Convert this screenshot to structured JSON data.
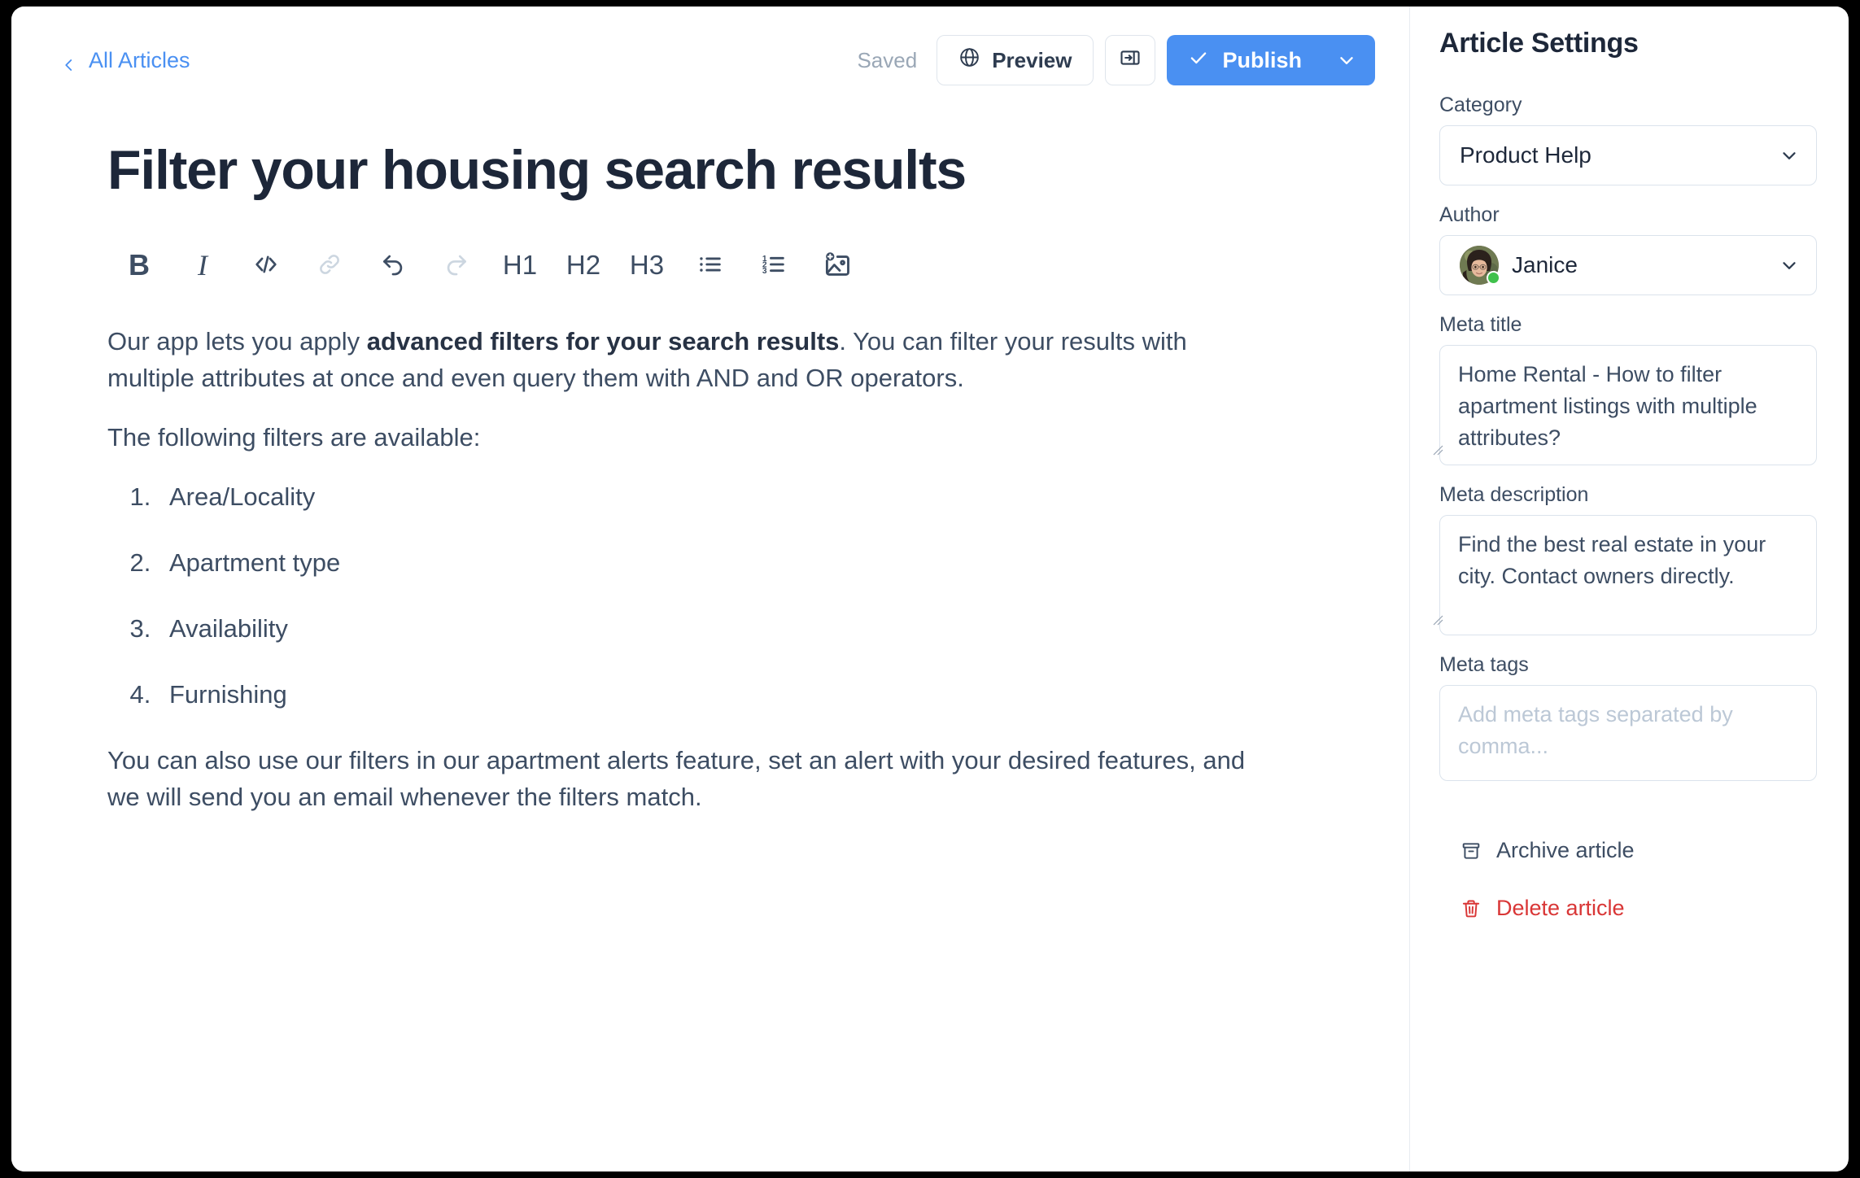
{
  "topbar": {
    "back_label": "All Articles",
    "saved_label": "Saved",
    "preview_label": "Preview",
    "publish_label": "Publish",
    "icons": {
      "back": "chevron-left-icon",
      "globe": "globe-icon",
      "panel": "panel-collapse-icon",
      "check": "check-icon",
      "caret": "chevron-down-icon"
    }
  },
  "article": {
    "title": "Filter your housing search results",
    "toolbar": [
      {
        "name": "bold",
        "label": "B",
        "kind": "bold",
        "disabled": false
      },
      {
        "name": "italic",
        "label": "I",
        "kind": "italic",
        "disabled": false
      },
      {
        "name": "code",
        "label": "</>",
        "kind": "icon",
        "disabled": false
      },
      {
        "name": "link",
        "label": "",
        "kind": "icon",
        "disabled": true
      },
      {
        "name": "undo",
        "label": "",
        "kind": "icon",
        "disabled": false
      },
      {
        "name": "redo",
        "label": "",
        "kind": "icon",
        "disabled": true
      },
      {
        "name": "heading-1",
        "label": "H1",
        "kind": "text",
        "disabled": false
      },
      {
        "name": "heading-2",
        "label": "H2",
        "kind": "text",
        "disabled": false
      },
      {
        "name": "heading-3",
        "label": "H3",
        "kind": "text",
        "disabled": false
      },
      {
        "name": "bullet-list",
        "label": "",
        "kind": "icon",
        "disabled": false
      },
      {
        "name": "numbered-list",
        "label": "",
        "kind": "icon",
        "disabled": false
      },
      {
        "name": "add-image",
        "label": "",
        "kind": "icon",
        "disabled": false
      }
    ],
    "para1_a": "Our app lets you apply ",
    "para1_bold": "advanced filters for your search results",
    "para1_b": ". You can filter your results with multiple attributes at once and even query them with AND and OR operators.",
    "para2": "The following filters are available:",
    "list": [
      "Area/Locality",
      "Apartment type",
      "Availability",
      "Furnishing"
    ],
    "para3": "You can also use our filters in our apartment alerts feature, set an alert with your desired features, and we will send you an email whenever the filters match."
  },
  "settings": {
    "title": "Article Settings",
    "category_label": "Category",
    "category_value": "Product Help",
    "author_label": "Author",
    "author_value": "Janice",
    "meta_title_label": "Meta title",
    "meta_title_value": "Home Rental - How to filter apartment listings with multiple attributes?",
    "meta_desc_label": "Meta description",
    "meta_desc_value": "Find the best real estate in your city. Contact owners directly.",
    "meta_tags_label": "Meta tags",
    "meta_tags_value": "",
    "meta_tags_placeholder": "Add meta tags separated by comma...",
    "archive_label": "Archive article",
    "delete_label": "Delete article"
  },
  "colors": {
    "accent_blue": "#4a90f2",
    "danger_red": "#d93636",
    "text_dark": "#1d2739",
    "text_body": "#3d4d63",
    "muted": "#9aa7b6",
    "border": "#dbe3ec",
    "online_green": "#3fc14c"
  }
}
